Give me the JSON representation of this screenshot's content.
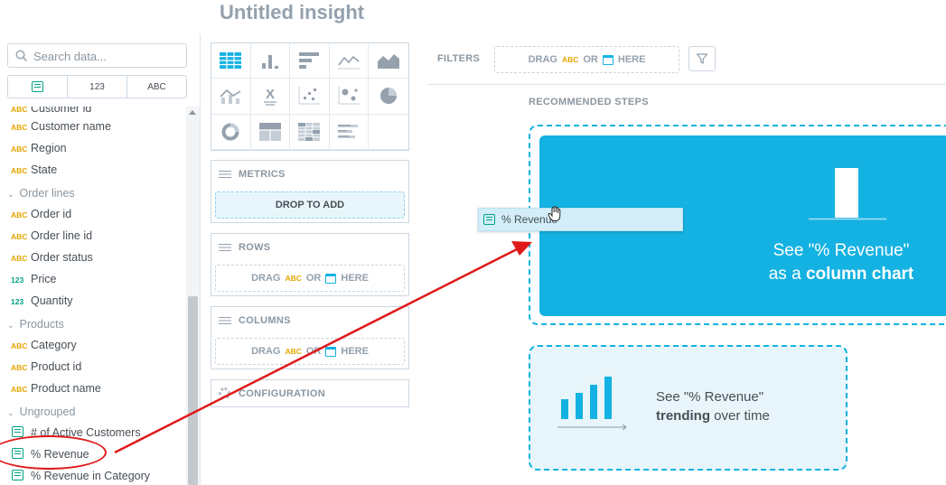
{
  "title": "Untitled insight",
  "search": {
    "placeholder": "Search data..."
  },
  "type_filter": {
    "metrics_icon": "metric-icon",
    "numbers_label": "123",
    "text_label": "ABC"
  },
  "catalog": {
    "partial_top": {
      "tag": "ABC",
      "label": "Customer id"
    },
    "items_top": [
      {
        "tag": "ABC",
        "label": "Customer name"
      },
      {
        "tag": "ABC",
        "label": "Region"
      },
      {
        "tag": "ABC",
        "label": "State"
      }
    ],
    "group_order_lines": "Order lines",
    "order_lines_items": [
      {
        "tag": "ABC",
        "label": "Order id"
      },
      {
        "tag": "ABC",
        "label": "Order line id"
      },
      {
        "tag": "ABC",
        "label": "Order status"
      },
      {
        "tag": "123",
        "label": "Price"
      },
      {
        "tag": "123",
        "label": "Quantity"
      }
    ],
    "group_products": "Products",
    "products_items": [
      {
        "tag": "ABC",
        "label": "Category"
      },
      {
        "tag": "ABC",
        "label": "Product id"
      },
      {
        "tag": "ABC",
        "label": "Product name"
      }
    ],
    "group_ungrouped": "Ungrouped",
    "ungrouped_items": [
      {
        "label": "# of Active Customers"
      },
      {
        "label": "% Revenue"
      },
      {
        "label": "% Revenue in Category"
      }
    ]
  },
  "buckets": {
    "metrics": {
      "title": "METRICS",
      "drop": "DROP TO ADD"
    },
    "rows": {
      "title": "ROWS",
      "drag": "DRAG",
      "abc": "ABC",
      "or": "OR",
      "here": "HERE"
    },
    "columns": {
      "title": "COLUMNS",
      "drag": "DRAG",
      "abc": "ABC",
      "or": "OR",
      "here": "HERE"
    },
    "configuration": "CONFIGURATION"
  },
  "filters": {
    "label": "FILTERS",
    "drag": "DRAG",
    "abc": "ABC",
    "or": "OR",
    "here": "HERE"
  },
  "recommended": {
    "label": "RECOMMENDED STEPS",
    "column_line1": "See \"% Revenue\"",
    "column_line2_prefix": "as a ",
    "column_line2_bold": "column chart",
    "trend_line1": "See \"% Revenue\"",
    "trend_line2_bold": "trending",
    "trend_line2_suffix": " over time"
  },
  "drag_chip": {
    "label": "% Revenue"
  },
  "colors": {
    "accent": "#14b2e2",
    "abc": "#e5a600",
    "number": "#00a383",
    "annotation": "#e01818"
  }
}
